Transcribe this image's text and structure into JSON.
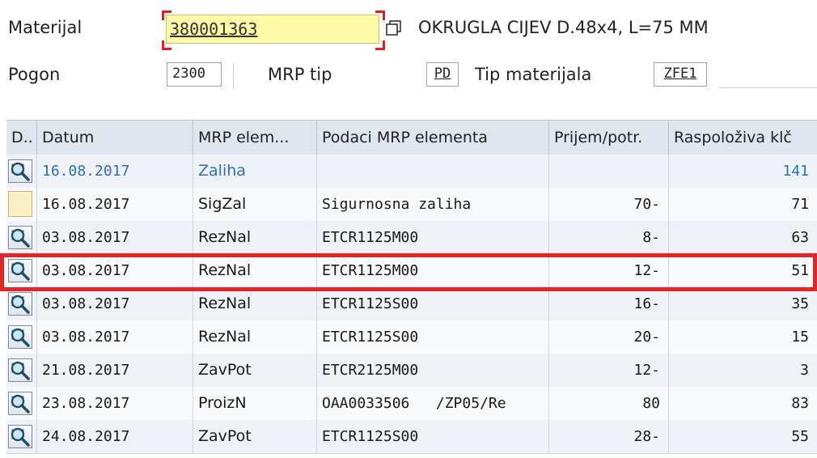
{
  "header": {
    "material_label": "Materijal",
    "material_value": "380001363",
    "material_desc": "OKRUGLA CIJEV D.48x4, L=75 MM",
    "plant_label": "Pogon",
    "plant_value": "2300",
    "mrp_type_label": "MRP tip",
    "mrp_type_value": "PD",
    "material_type_label": "Tip materijala",
    "material_type_value": "ZFE1"
  },
  "table": {
    "columns": [
      "D..",
      "Datum",
      "MRP elem...",
      "Podaci MRP elementa",
      "Prijem/potr.",
      "Raspoloživa klč"
    ],
    "rows": [
      {
        "icon": "details-icon",
        "date": "16.08.2017",
        "element": "Zaliha",
        "data": "",
        "qty": "",
        "avail": "141"
      },
      {
        "icon": "empty",
        "date": "16.08.2017",
        "element": "SigZal",
        "data": "Sigurnosna zaliha",
        "qty": "70-",
        "avail": "71"
      },
      {
        "icon": "details-icon",
        "date": "03.08.2017",
        "element": "RezNal",
        "data": "ETCR1125M00",
        "qty": "8-",
        "avail": "63"
      },
      {
        "icon": "details-icon",
        "date": "03.08.2017",
        "element": "RezNal",
        "data": "ETCR1125M00",
        "qty": "12-",
        "avail": "51"
      },
      {
        "icon": "details-icon",
        "date": "03.08.2017",
        "element": "RezNal",
        "data": "ETCR1125S00",
        "qty": "16-",
        "avail": "35"
      },
      {
        "icon": "details-icon",
        "date": "03.08.2017",
        "element": "RezNal",
        "data": "ETCR1125S00",
        "qty": "20-",
        "avail": "15"
      },
      {
        "icon": "details-icon",
        "date": "21.08.2017",
        "element": "ZavPot",
        "data": "ETCR2125M00",
        "qty": "12-",
        "avail": "3"
      },
      {
        "icon": "details-icon",
        "date": "23.08.2017",
        "element": "ProizN",
        "data": "OAA0033506   /ZP05/Re",
        "qty": "80",
        "avail": "83"
      },
      {
        "icon": "details-icon",
        "date": "24.08.2017",
        "element": "ZavPot",
        "data": "ETCR1125S00",
        "qty": "28-",
        "avail": "55"
      }
    ]
  },
  "colors": {
    "highlight": "#e0262b",
    "link_blue": "#2f6fb6",
    "material_field": "#fff9a8"
  }
}
